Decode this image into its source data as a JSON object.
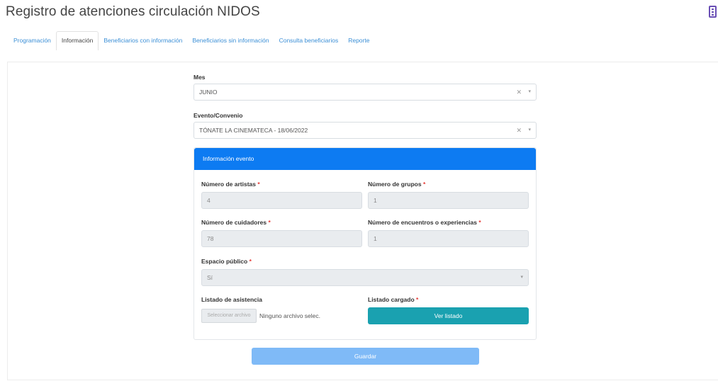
{
  "header": {
    "title": "Registro de atenciones circulación NIDOS",
    "menu_icon": "menu-icon"
  },
  "tabs": [
    {
      "label": "Programación",
      "active": false
    },
    {
      "label": "Información",
      "active": true
    },
    {
      "label": "Beneficiarios con información",
      "active": false
    },
    {
      "label": "Beneficiarios sin información",
      "active": false
    },
    {
      "label": "Consulta beneficiarios",
      "active": false
    },
    {
      "label": "Reporte",
      "active": false
    }
  ],
  "form": {
    "mes": {
      "label": "Mes",
      "value": "JUNIO"
    },
    "evento": {
      "label": "Evento/Convenio",
      "value": "TÓNATE LA CINEMATECA - 18/06/2022"
    },
    "clear_symbol": "✕",
    "caret_symbol": "▾"
  },
  "evento_card": {
    "header": "Información evento",
    "num_artistas": {
      "label": "Número de artistas",
      "value": "4"
    },
    "num_grupos": {
      "label": "Número de grupos",
      "value": "1"
    },
    "num_cuidadores": {
      "label": "Número de cuidadores",
      "value": "78"
    },
    "num_encuentros": {
      "label": "Número de encuentros o experiencias",
      "value": "1"
    },
    "espacio_publico": {
      "label": "Espacio público",
      "value": "Sí"
    },
    "listado_asistencia": {
      "label": "Listado de asistencia",
      "file_button": "Seleccionar archivo",
      "file_name": "Ninguno archivo selec."
    },
    "listado_cargado": {
      "label": "Listado cargado",
      "button": "Ver listado"
    },
    "required_mark": "*"
  },
  "actions": {
    "save": "Guardar"
  },
  "colors": {
    "primary": "#0d7bf2",
    "teal": "#1aa1b0",
    "save": "#7fbaf7",
    "link": "#3b8fd6"
  }
}
